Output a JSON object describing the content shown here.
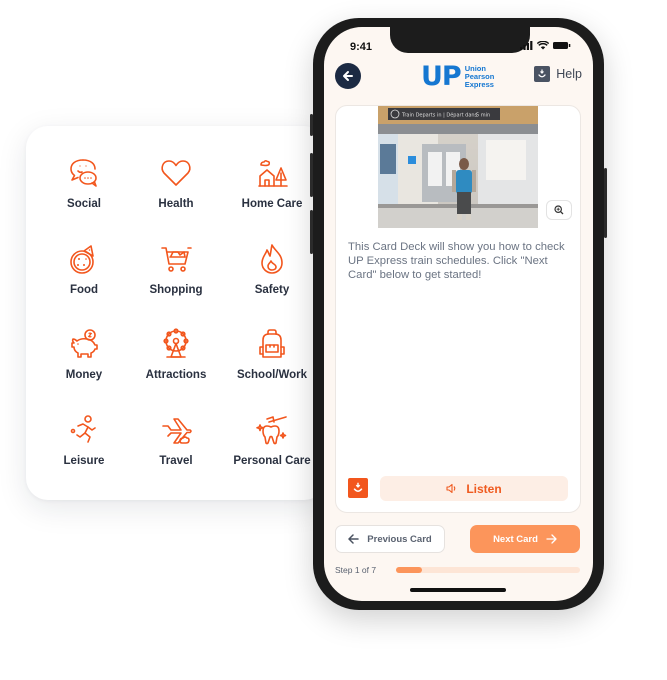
{
  "categories": [
    {
      "label": "Social",
      "icon": "chat-bubbles-icon"
    },
    {
      "label": "Health",
      "icon": "heart-icon"
    },
    {
      "label": "Home Care",
      "icon": "house-tree-icon"
    },
    {
      "label": "Food",
      "icon": "pizza-icon"
    },
    {
      "label": "Shopping",
      "icon": "shopping-cart-icon"
    },
    {
      "label": "Safety",
      "icon": "flame-icon"
    },
    {
      "label": "Money",
      "icon": "piggy-bank-icon"
    },
    {
      "label": "Attractions",
      "icon": "ferris-wheel-icon"
    },
    {
      "label": "School/Work",
      "icon": "backpack-icon"
    },
    {
      "label": "Leisure",
      "icon": "running-person-icon"
    },
    {
      "label": "Travel",
      "icon": "airplane-icon"
    },
    {
      "label": "Personal Care",
      "icon": "tooth-brush-icon"
    }
  ],
  "colors": {
    "accent": "#f2561d",
    "accent_light": "#fc955b",
    "brand_blue": "#1577d1",
    "navy": "#1c2a43"
  },
  "phone": {
    "status": {
      "time": "9:41"
    },
    "header": {
      "logo_mark": "UP",
      "logo_line1": "Union",
      "logo_line2": "Pearson",
      "logo_line3": "Express",
      "help_label": "Help"
    },
    "card": {
      "sign_text": "Train Departs in | Départ dans",
      "sign_time": "5 min",
      "body_text": "This Card Deck will show you how to check UP Express train schedules. Click \"Next Card\" below to get started!",
      "listen_label": "Listen"
    },
    "nav": {
      "previous_label": "Previous Card",
      "next_label": "Next Card"
    },
    "progress": {
      "label": "Step 1 of 7",
      "current": 1,
      "total": 7
    }
  }
}
